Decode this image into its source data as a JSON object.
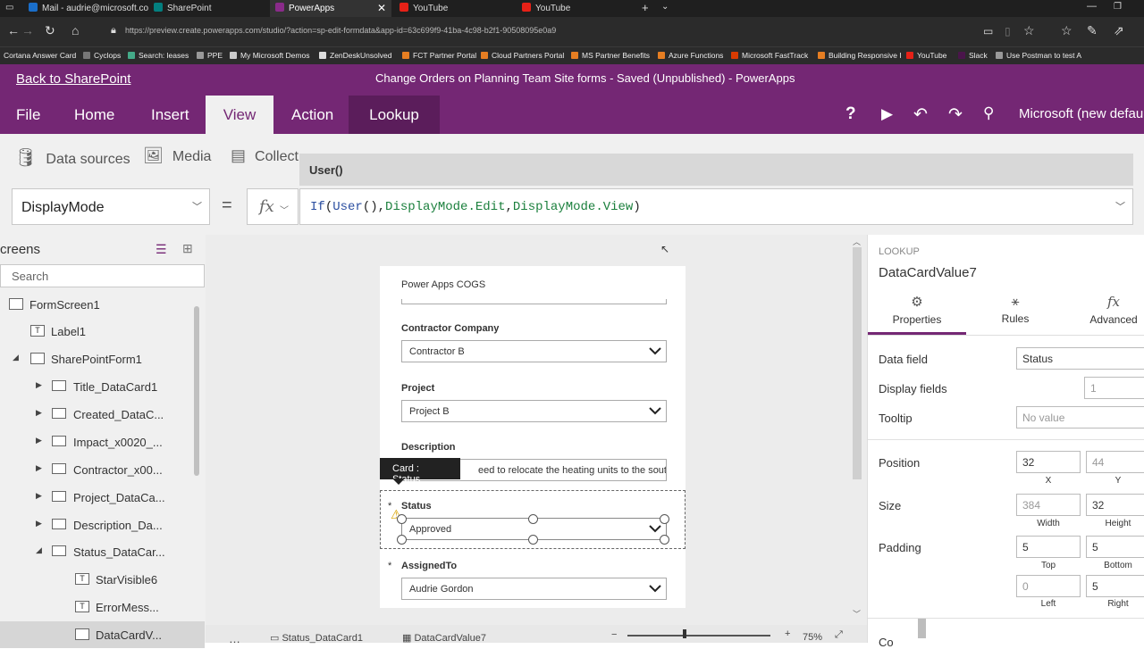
{
  "browser": {
    "tabs": [
      {
        "label": "Mail - audrie@microsoft.co",
        "icon": "outlook-icon",
        "color": "#1a6ec9"
      },
      {
        "label": "SharePoint",
        "icon": "sharepoint-icon",
        "color": "#037f7f"
      },
      {
        "label": "PowerApps",
        "icon": "powerapps-icon",
        "color": "#8a2b8a"
      },
      {
        "label": "YouTube",
        "icon": "youtube-icon",
        "color": "#e62117"
      },
      {
        "label": "YouTube",
        "icon": "youtube-icon",
        "color": "#e62117"
      }
    ],
    "url": "https://preview.create.powerapps.com/studio/?action=sp-edit-formdata&app-id=63c699f9-41ba-4c98-b2f1-90508095e0a9",
    "favorites": [
      "Cortana Answer Card",
      "Cyclops",
      "Search: leases",
      "PPE",
      "My Microsoft Demos",
      "ZenDeskUnsolved",
      "FCT Partner Portal",
      "Cloud Partners Portal",
      "MS Partner Benefits",
      "Azure Functions",
      "Microsoft FastTrack",
      "Building Responsive I",
      "YouTube",
      "Slack",
      "Use Postman to test A"
    ]
  },
  "app": {
    "back_link": "Back to SharePoint",
    "title": "Change Orders on Planning Team Site forms - Saved (Unpublished) - PowerApps",
    "brand_color": "#742774",
    "ribbon_tabs": [
      "File",
      "Home",
      "Insert",
      "View",
      "Action",
      "Lookup"
    ],
    "active_tab": "View",
    "tenant": "Microsoft (new default"
  },
  "toolbar": {
    "data_sources": "Data sources",
    "media": "Media",
    "collections": "Collect"
  },
  "formula": {
    "property": "DisplayMode",
    "equals": "=",
    "fx": "fx",
    "tooltip": "User()",
    "parts": [
      "If",
      "(",
      "User",
      "(",
      ")",
      ",",
      "DisplayMode",
      ".Edit",
      ",",
      "DisplayMode",
      ".View",
      ")"
    ]
  },
  "tree": {
    "header": "creens",
    "search_placeholder": "Search",
    "items": [
      {
        "label": "FormScreen1",
        "icon": "screen-icon"
      },
      {
        "label": "Label1",
        "icon": "label-icon"
      },
      {
        "label": "SharePointForm1",
        "icon": "form-icon"
      },
      {
        "label": "Title_DataCard1",
        "icon": "card-icon"
      },
      {
        "label": "Created_DataC...",
        "icon": "card-icon"
      },
      {
        "label": "Impact_x0020_...",
        "icon": "card-icon"
      },
      {
        "label": "Contractor_x00...",
        "icon": "card-icon"
      },
      {
        "label": "Project_DataCa...",
        "icon": "card-icon"
      },
      {
        "label": "Description_Da...",
        "icon": "card-icon"
      },
      {
        "label": "Status_DataCar...",
        "icon": "card-icon"
      },
      {
        "label": "StarVisible6",
        "icon": "label-icon"
      },
      {
        "label": "ErrorMess...",
        "icon": "label-icon"
      },
      {
        "label": "DataCardV...",
        "icon": "dropdown-icon"
      }
    ]
  },
  "form": {
    "top_value": "Power Apps COGS",
    "contractor_label": "Contractor Company",
    "contractor_value": "Contractor B",
    "project_label": "Project",
    "project_value": "Project B",
    "description_label": "Description",
    "description_value": "eed to relocate the heating units to the south wa",
    "card_tip": "Card : Status",
    "status_label": "Status",
    "status_value": "Approved",
    "assigned_label": "AssignedTo",
    "assigned_value": "Audrie Gordon",
    "required_star": "*"
  },
  "statusbar": {
    "crumb1": "Status_DataCard1",
    "crumb2": "DataCardValue7",
    "zoom": "75%"
  },
  "panel": {
    "kind": "LOOKUP",
    "name": "DataCardValue7",
    "tabs": [
      "Properties",
      "Rules",
      "Advanced"
    ],
    "data_field_label": "Data field",
    "data_field_value": "Status",
    "display_fields_label": "Display fields",
    "display_fields_value": "1",
    "tooltip_label": "Tooltip",
    "tooltip_value": "No value",
    "position_label": "Position",
    "x": "32",
    "y": "44",
    "x_label": "X",
    "y_label": "Y",
    "size_label": "Size",
    "width": "384",
    "height": "32",
    "width_label": "Width",
    "height_label": "Height",
    "padding_label": "Padding",
    "top": "5",
    "bottom": "5",
    "left": "0",
    "right": "5",
    "top_label": "Top",
    "bottom_label": "Bottom",
    "left_label": "Left",
    "right_label": "Right",
    "color_label": "Co"
  }
}
